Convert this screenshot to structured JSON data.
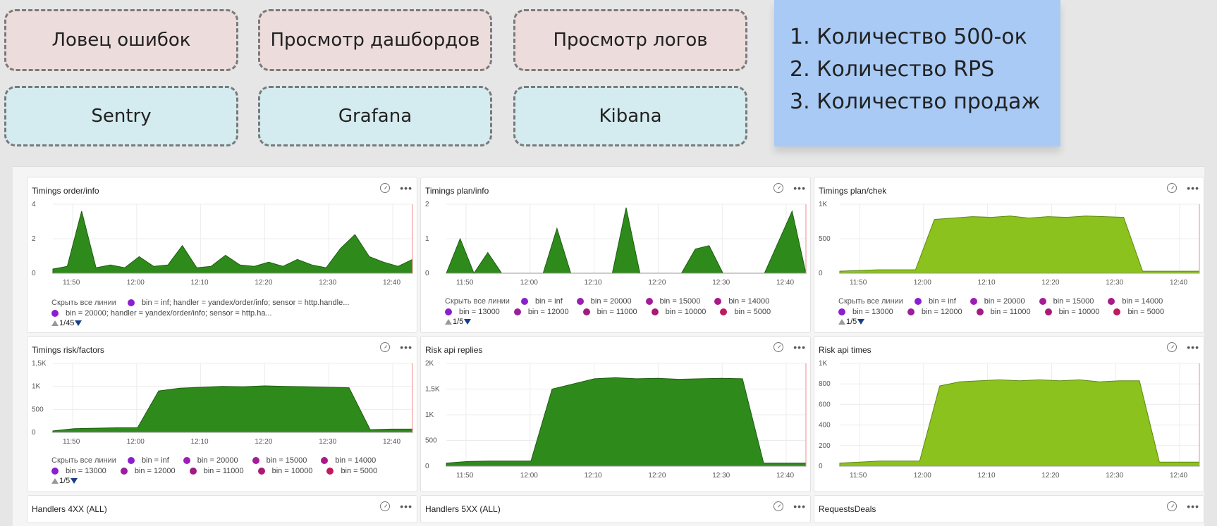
{
  "board": {
    "row1": [
      "Ловец ошибок",
      "Просмотр дашбордов",
      "Просмотр логов"
    ],
    "row2": [
      "Sentry",
      "Grafana",
      "Kibana"
    ],
    "note": [
      "1. Количество 500-ок",
      "2. Количество RPS",
      "3. Количество продаж"
    ]
  },
  "colors": {
    "pink_chip": "#ecdcdc",
    "cyan_chip": "#d4ebef",
    "note": "#a8caf5",
    "series_green": "#2f8a1c",
    "series_lime": "#8cc21d"
  },
  "legend_common": {
    "hide_all": "Скрыть все линии",
    "items": [
      {
        "label": "bin = inf",
        "color": "#8b1fd0"
      },
      {
        "label": "bin = 20000",
        "color": "#9b1fb5"
      },
      {
        "label": "bin = 15000",
        "color": "#a41c9a"
      },
      {
        "label": "bin = 14000",
        "color": "#a81a8a"
      },
      {
        "label": "bin = 13000",
        "color": "#8b1fd0"
      },
      {
        "label": "bin = 12000",
        "color": "#9b1f9a"
      },
      {
        "label": "bin = 11000",
        "color": "#a11c82"
      },
      {
        "label": "bin = 10000",
        "color": "#aa1a74"
      },
      {
        "label": "bin = 5000",
        "color": "#c01a5e"
      }
    ],
    "pager": "1/5"
  },
  "legend_order": {
    "items": [
      {
        "label": "bin = inf; handler = yandex/order/info; sensor = http.handle...",
        "color": "#8b1fd0"
      },
      {
        "label": "bin = 20000; handler = yandex/order/info; sensor = http.ha...",
        "color": "#8b1fd0"
      }
    ],
    "pager": "1/45"
  },
  "bottom_titles": [
    "Handlers 4XX (ALL)",
    "Handlers 5XX (ALL)",
    "RequestsDeals"
  ],
  "chart_data": [
    {
      "type": "area",
      "title": "Timings order/info",
      "x": [
        "11:50",
        "12:00",
        "12:10",
        "12:20",
        "12:30",
        "12:40"
      ],
      "ylim": [
        0,
        5
      ],
      "yticks": [
        "0",
        "2",
        "4"
      ],
      "series": [
        {
          "values": [
            0.3,
            0.5,
            4.5,
            0.4,
            0.6,
            0.4,
            1.2,
            0.5,
            0.6,
            2.0,
            0.4,
            0.5,
            1.3,
            0.6,
            0.5,
            0.8,
            0.5,
            1.0,
            0.6,
            0.4,
            1.8,
            2.8,
            1.2,
            0.8,
            0.5,
            1.0
          ]
        }
      ]
    },
    {
      "type": "area",
      "title": "Timings plan/info",
      "x": [
        "11:50",
        "12:00",
        "12:10",
        "12:20",
        "12:30",
        "12:40"
      ],
      "ylim": [
        0,
        2
      ],
      "yticks": [
        "0",
        "1",
        "2"
      ],
      "series": [
        {
          "values": [
            0.0,
            1.0,
            0.0,
            0.6,
            0.0,
            0.0,
            0.0,
            0.0,
            1.3,
            0.0,
            0.0,
            0.0,
            0.0,
            1.9,
            0.0,
            0.0,
            0.0,
            0.0,
            0.7,
            0.8,
            0.0,
            0.0,
            0.0,
            0.0,
            0.9,
            1.8,
            0.0
          ]
        }
      ]
    },
    {
      "type": "area",
      "title": "Timings plan/chek",
      "x": [
        "11:50",
        "12:00",
        "12:10",
        "12:20",
        "12:30",
        "12:40"
      ],
      "ylim": [
        0,
        1000
      ],
      "yticks": [
        "0",
        "500",
        "1K"
      ],
      "series": [
        {
          "values": [
            30,
            40,
            50,
            50,
            50,
            780,
            800,
            820,
            810,
            830,
            800,
            820,
            810,
            830,
            820,
            810,
            30,
            30,
            30,
            30
          ]
        }
      ]
    },
    {
      "type": "area",
      "title": "Timings risk/factors",
      "x": [
        "11:50",
        "12:00",
        "12:10",
        "12:20",
        "12:30",
        "12:40"
      ],
      "ylim": [
        0,
        1500
      ],
      "yticks": [
        "0",
        "500",
        "1K",
        "1,5K"
      ],
      "series": [
        {
          "values": [
            30,
            80,
            90,
            100,
            100,
            900,
            960,
            980,
            1000,
            990,
            1010,
            1000,
            990,
            980,
            970,
            60,
            70,
            70
          ]
        }
      ]
    },
    {
      "type": "area",
      "title": "Risk api replies",
      "x": [
        "11:50",
        "12:00",
        "12:10",
        "12:20",
        "12:30",
        "12:40"
      ],
      "ylim": [
        0,
        2000
      ],
      "yticks": [
        "0",
        "500",
        "1K",
        "1,5K",
        "2K"
      ],
      "series": [
        {
          "values": [
            60,
            90,
            100,
            100,
            100,
            1500,
            1600,
            1700,
            1720,
            1700,
            1710,
            1690,
            1700,
            1710,
            1700,
            60,
            60,
            60
          ]
        }
      ]
    },
    {
      "type": "area",
      "title": "Risk api times",
      "x": [
        "11:50",
        "12:00",
        "12:10",
        "12:20",
        "12:30",
        "12:40"
      ],
      "ylim": [
        0,
        1000
      ],
      "yticks": [
        "0",
        "200",
        "400",
        "600",
        "800",
        "1K"
      ],
      "series": [
        {
          "values": [
            30,
            40,
            50,
            50,
            50,
            780,
            820,
            830,
            840,
            830,
            840,
            830,
            840,
            820,
            830,
            830,
            40,
            40,
            40
          ]
        }
      ]
    }
  ]
}
